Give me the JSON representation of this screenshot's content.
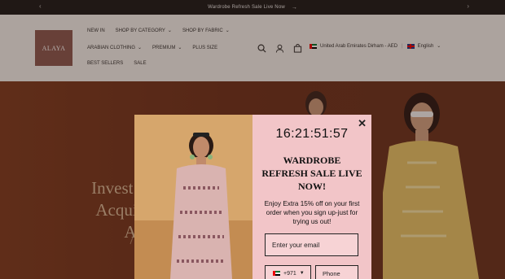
{
  "announcement": {
    "text": "Wardrobe Refresh Sale Live Now",
    "arrow": "→",
    "prev": "‹",
    "next": "›"
  },
  "brand": {
    "logo_text": "ALAYA"
  },
  "nav": {
    "row1": [
      {
        "label": "NEW IN",
        "dropdown": false
      },
      {
        "label": "SHOP BY CATEGORY",
        "dropdown": true
      },
      {
        "label": "SHOP BY FABRIC",
        "dropdown": true
      }
    ],
    "row2": [
      {
        "label": "ARABIAN CLOTHING",
        "dropdown": true
      },
      {
        "label": "PREMIUM",
        "dropdown": true
      },
      {
        "label": "PLUS SIZE",
        "dropdown": false
      }
    ],
    "row3": [
      {
        "label": "BEST SELLERS",
        "dropdown": false
      },
      {
        "label": "SALE",
        "dropdown": false
      }
    ]
  },
  "header_icons": [
    "search-icon",
    "account-icon",
    "cart-icon"
  ],
  "locale": {
    "country": "United Arab Emirates Dirham - AED",
    "language": "English"
  },
  "hero": {
    "lines": [
      "Invest in Ti",
      "Acquire T",
      "A"
    ]
  },
  "popup": {
    "close": "✕",
    "timer": "16:21:51:57",
    "headline": "WARDROBE REFRESH SALE LIVE NOW!",
    "offer": "Enjoy Extra 15% off on your first order when you sign up-just for trying us out!",
    "email_placeholder": "Enter your email",
    "country_code": "+971",
    "phone_placeholder": "Phone"
  },
  "colors": {
    "hero_bg": "#6f3420",
    "popup_bg": "#f2c5c8",
    "logo_bg": "#8a5a52"
  }
}
